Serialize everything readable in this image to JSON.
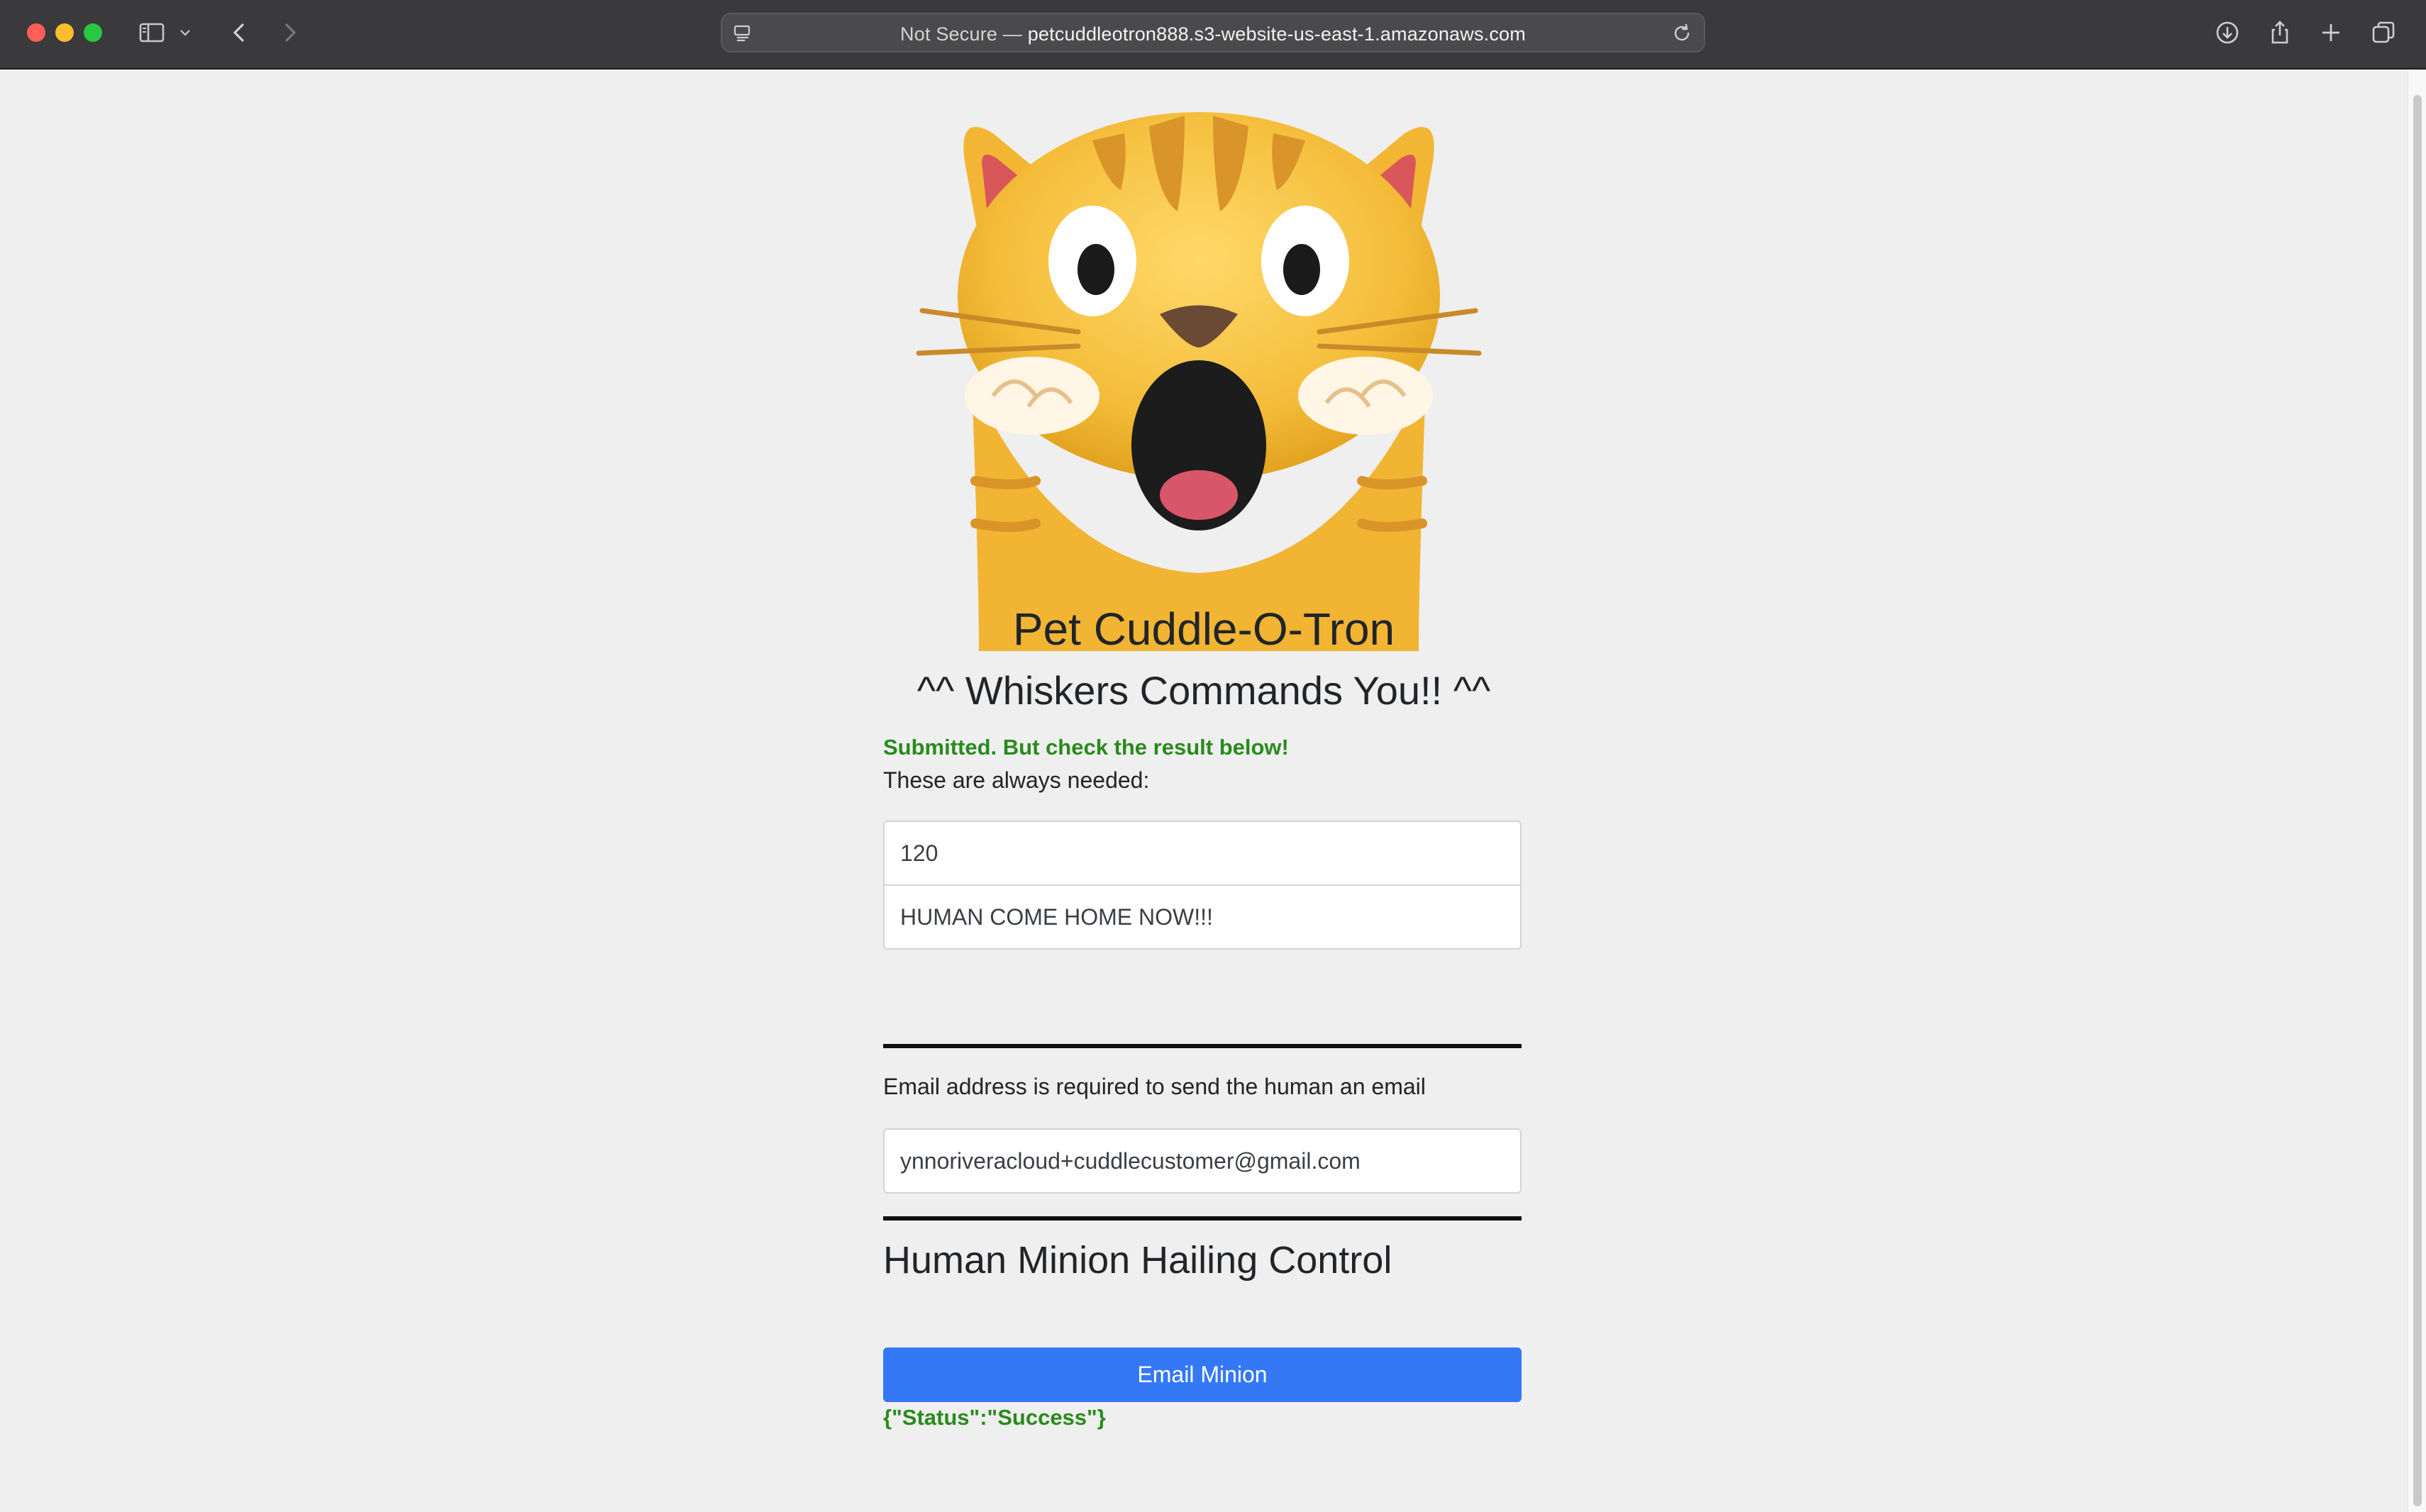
{
  "browser": {
    "address_prefix": "Not Secure — ",
    "address_host": "petcuddleotron888.s3-website-us-east-1.amazonaws.com",
    "icons": [
      "sidebar-icon",
      "chevron-down-icon",
      "back-icon",
      "forward-icon",
      "page-menu-icon",
      "reload-icon",
      "download-icon",
      "share-icon",
      "new-tab-icon",
      "tab-overview-icon"
    ]
  },
  "page": {
    "heading": "Pet Cuddle-O-Tron",
    "subheading": "^^ Whiskers Commands You!! ^^",
    "submit_status": "Submitted. But check the result below!",
    "always_needed_label": "These are always needed:",
    "waitseconds_value": "120",
    "message_value": "HUMAN COME HOME NOW!!!",
    "email_label": "Email address is required to send the human an email",
    "email_value": "ynnoriveracloud+cuddlecustomer@gmail.com",
    "control_title": "Human Minion Hailing Control",
    "email_button": "Email Minion",
    "result": "{\"Status\":\"Success\"}"
  },
  "colors": {
    "success_text": "#2a8a1d",
    "button_bg": "#3478f6",
    "page_bg": "#efefef"
  }
}
